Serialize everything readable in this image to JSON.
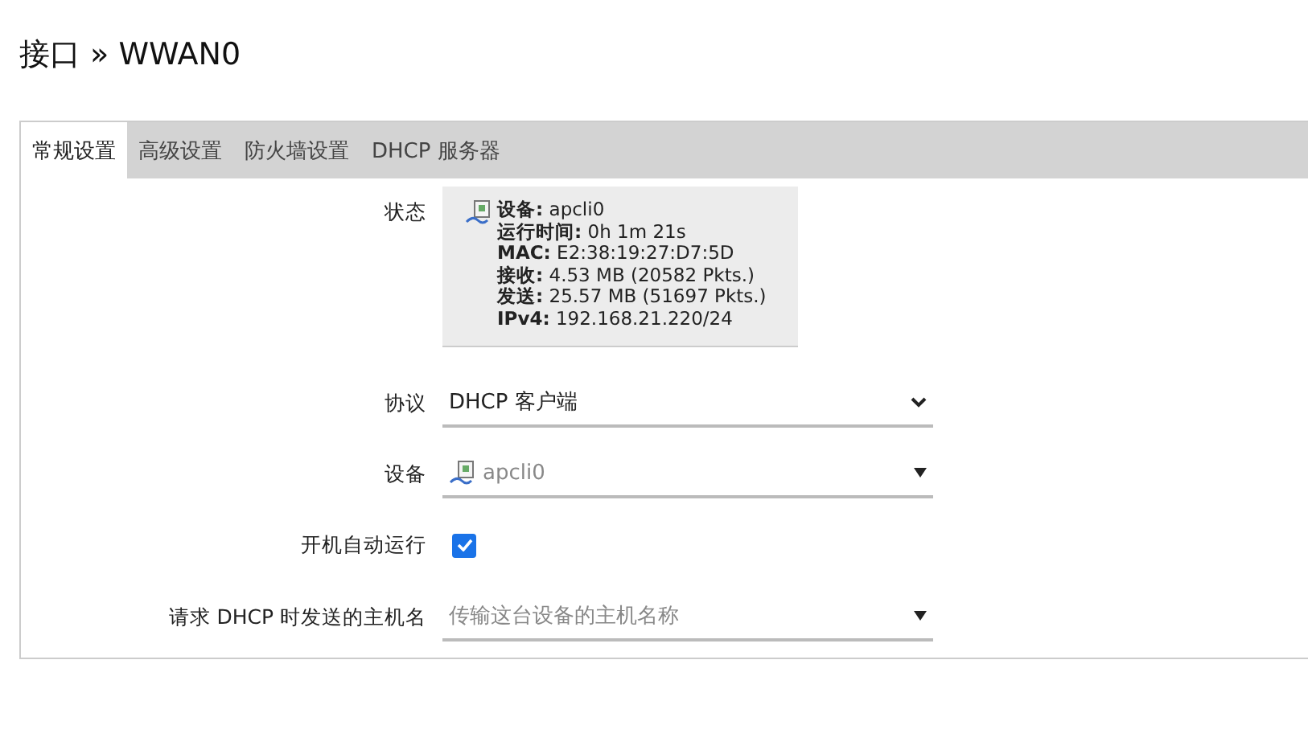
{
  "page_title": "接口 » WWAN0",
  "tabs": [
    {
      "label": "常规设置",
      "selected": true
    },
    {
      "label": "高级设置",
      "selected": false
    },
    {
      "label": "防火墙设置",
      "selected": false
    },
    {
      "label": "DHCP 服务器",
      "selected": false
    }
  ],
  "status": {
    "label": "状态",
    "lines": [
      {
        "label": "设备:",
        "value": "apcli0"
      },
      {
        "label": "运行时间:",
        "value": "0h 1m 21s"
      },
      {
        "label": "MAC:",
        "value": "E2:38:19:27:D7:5D"
      },
      {
        "label": "接收:",
        "value": "4.53 MB (20582 Pkts.)"
      },
      {
        "label": "发送:",
        "value": "25.57 MB (51697 Pkts.)"
      },
      {
        "label": "IPv4:",
        "value": "192.168.21.220/24"
      }
    ]
  },
  "fields": [
    {
      "kind": "select",
      "label": "协议",
      "value": "DHCP 客户端"
    },
    {
      "kind": "device",
      "label": "设备",
      "value": "apcli0"
    },
    {
      "kind": "checkbox",
      "label": "开机自动运行",
      "checked": true
    },
    {
      "kind": "combo",
      "label": "请求 DHCP 时发送的主机名",
      "placeholder": "传输这台设备的主机名称"
    }
  ]
}
